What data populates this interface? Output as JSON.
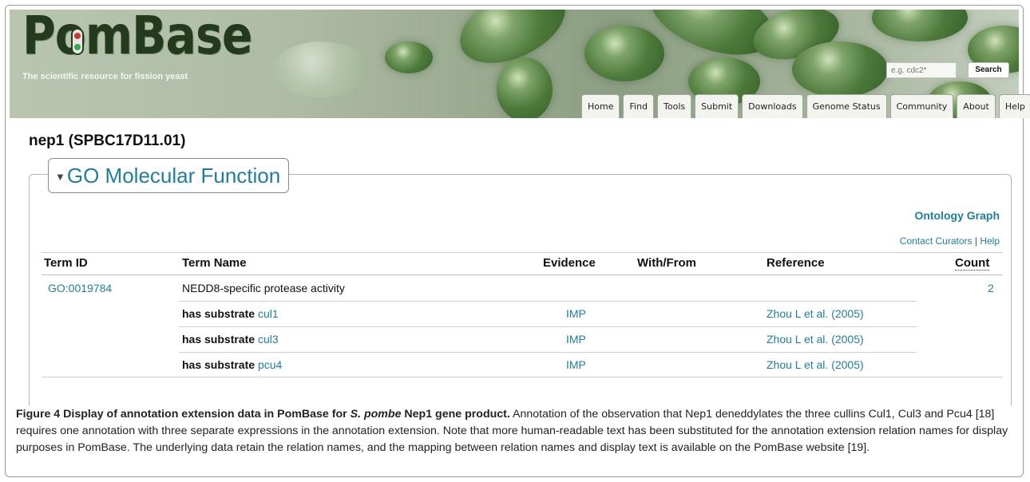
{
  "header": {
    "logo_text": "PomBase",
    "tagline": "The scientific resource for fission yeast",
    "search": {
      "placeholder": "e.g. cdc2*",
      "button_label": "Search"
    },
    "nav_tabs": [
      "Home",
      "Find",
      "Tools",
      "Submit",
      "Downloads",
      "Genome Status",
      "Community",
      "About",
      "Help"
    ]
  },
  "gene": {
    "title": "nep1 (SPBC17D11.01)"
  },
  "section": {
    "title": "GO Molecular Function",
    "ontology_graph_link": "Ontology Graph",
    "contact_link": "Contact Curators",
    "separator": "|",
    "help_link": "Help"
  },
  "table": {
    "headers": {
      "term_id": "Term ID",
      "term_name": "Term Name",
      "evidence": "Evidence",
      "with_from": "With/From",
      "reference": "Reference",
      "count": "Count"
    },
    "annotation": {
      "term_id": "GO:0019784",
      "term_name": "NEDD8-specific protease activity",
      "count": "2",
      "extensions": [
        {
          "relation": "has substrate",
          "target": "cul1",
          "evidence": "IMP",
          "reference": "Zhou L et al. (2005)"
        },
        {
          "relation": "has substrate",
          "target": "cul3",
          "evidence": "IMP",
          "reference": "Zhou L et al. (2005)"
        },
        {
          "relation": "has substrate",
          "target": "pcu4",
          "evidence": "IMP",
          "reference": "Zhou L et al. (2005)"
        }
      ]
    }
  },
  "caption": {
    "label": "Figure 4 Display of annotation extension data in PomBase for ",
    "species": "S. pombe",
    "label_end": " Nep1 gene product.",
    "body": " Annotation of the observation that Nep1 deneddylates the three cullins Cul1, Cul3 and Pcu4 [18] requires one annotation with three separate expressions in the annotation extension. Note that more human-readable text has been substituted for the annotation extension relation names for display purposes in PomBase. The underlying data retain the relation names, and the mapping between relation names and display text is available on the PomBase website [19]."
  },
  "colors": {
    "link": "#1f7e9e",
    "logo": "#243a1c",
    "banner": "#9fae94"
  }
}
